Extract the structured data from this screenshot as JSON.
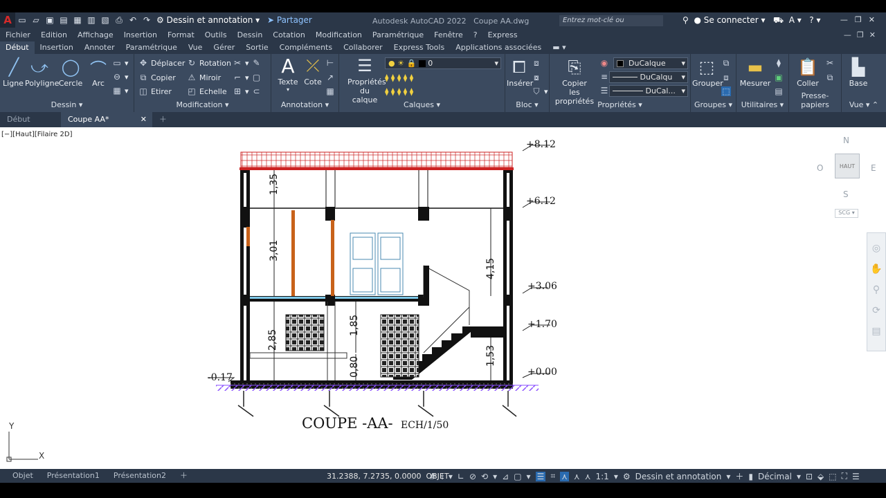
{
  "app": {
    "title": "Autodesk AutoCAD 2022",
    "document": "Coupe AA.dwg",
    "workspace": "Dessin et annotation",
    "share_label": "Partager",
    "search_placeholder": "Entrez mot-clé ou expression",
    "account_label": "Se connecter",
    "logo": "A"
  },
  "menu": [
    "Fichier",
    "Edition",
    "Affichage",
    "Insertion",
    "Format",
    "Outils",
    "Dessin",
    "Cotation",
    "Modification",
    "Paramétrique",
    "Fenêtre",
    "?",
    "Express"
  ],
  "ribbon_tabs": [
    "Début",
    "Insertion",
    "Annoter",
    "Paramétrique",
    "Vue",
    "Gérer",
    "Sortie",
    "Compléments",
    "Collaborer",
    "Express Tools",
    "Applications associées"
  ],
  "ribbon": {
    "dessin": {
      "label": "Dessin",
      "ligne": "Ligne",
      "polyligne": "Polyligne",
      "cercle": "Cercle",
      "arc": "Arc"
    },
    "modification": {
      "label": "Modification",
      "deplacer": "Déplacer",
      "rotation": "Rotation",
      "copier": "Copier",
      "miroir": "Miroir",
      "etirer": "Etirer",
      "echelle": "Echelle"
    },
    "annotation": {
      "label": "Annotation",
      "texte": "Texte",
      "cote": "Cote"
    },
    "calques": {
      "label": "Calques",
      "proprietes_line1": "Propriétés",
      "proprietes_line2": "du calque",
      "current_layer": "0"
    },
    "bloc": {
      "label": "Bloc",
      "inserer": "Insérer"
    },
    "proprietes": {
      "label": "Propriétés",
      "copier_line1": "Copier",
      "copier_line2": "les propriétés",
      "color": "DuCalque",
      "linetype": "DuCalqu",
      "lineweight": "DuCal..."
    },
    "groupes": {
      "label": "Groupes",
      "grouper": "Grouper"
    },
    "utilitaires": {
      "label": "Utilitaires",
      "mesurer": "Mesurer"
    },
    "presse": {
      "label": "Presse-papiers",
      "coller": "Coller"
    },
    "vue": {
      "label": "Vue",
      "base": "Base"
    }
  },
  "doc_tabs": {
    "start": "Début",
    "active": "Coupe AA*"
  },
  "viewport_label": "[−][Haut][Filaire 2D]",
  "viewcube": {
    "n": "N",
    "s": "S",
    "e": "E",
    "w": "O",
    "face": "HAUT",
    "ucs": "SCG"
  },
  "ucs_icon": {
    "x": "X",
    "y": "Y"
  },
  "drawing": {
    "title": "COUPE -AA-",
    "scale": "ECH/1/50",
    "levels": [
      "+8.12",
      "+6.12",
      "+3.06",
      "+1.70",
      "+0.00",
      "-0.17"
    ],
    "dims": [
      "1,35",
      "3,01",
      "4,15",
      "2,85",
      "1,85",
      "0,80",
      "1,53"
    ]
  },
  "layout_tabs": [
    "Objet",
    "Présentation1",
    "Présentation2"
  ],
  "status": {
    "coords": "31.2388, 7.2735, 0.0000",
    "mode": "OBJET",
    "scale": "1:1",
    "workspace": "Dessin et annotation",
    "units": "Décimal"
  },
  "colors": {
    "ribbon": "#3b4a5f",
    "chrome": "#2b3748",
    "roof_red": "#cc2222",
    "wood": "#c8621a",
    "hatch": "#8a4fff",
    "window": "#6a9fc0"
  }
}
